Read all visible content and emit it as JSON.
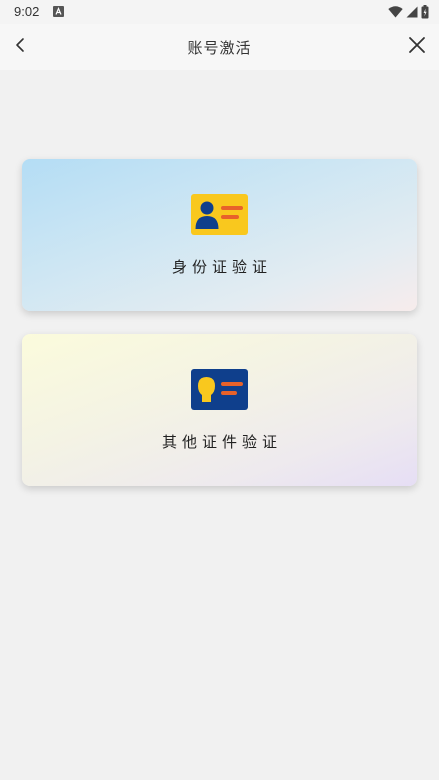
{
  "status_bar": {
    "time": "9:02",
    "icons": [
      "notification-a-icon",
      "wifi-icon",
      "signal-icon",
      "battery-icon"
    ]
  },
  "nav": {
    "title": "账号激活",
    "back_icon": "chevron-left-icon",
    "close_icon": "close-icon"
  },
  "cards": [
    {
      "id": "id-card",
      "label": "身份证验证",
      "icon": "id-card-icon"
    },
    {
      "id": "other-certificate",
      "label": "其他证件验证",
      "icon": "certificate-icon"
    }
  ],
  "colors": {
    "background": "#f1f1f1",
    "icon_yellow": "#f9c81e",
    "icon_navy": "#0f3f8c",
    "icon_orange": "#e8622a"
  }
}
